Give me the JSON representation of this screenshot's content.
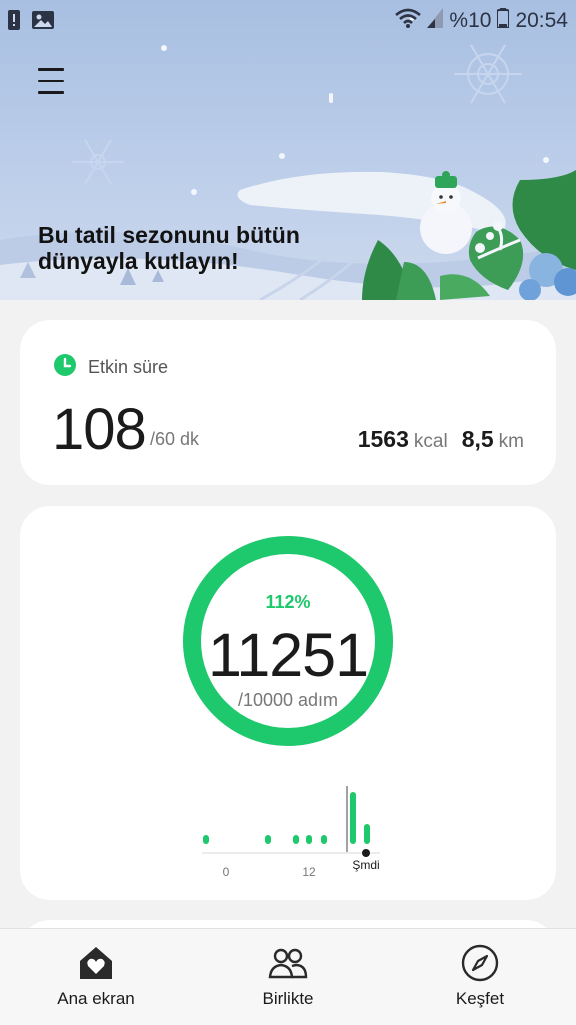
{
  "status_bar": {
    "battery_percent": "%10",
    "time": "20:54"
  },
  "banner": {
    "text": "Bu tatil sezonunu bütün dünyayla kutlayın!"
  },
  "active_time": {
    "title": "Etkin süre",
    "value": "108",
    "unit": "/60 dk",
    "calories_value": "1563",
    "calories_unit": "kcal",
    "distance_value": "8,5",
    "distance_unit": "km"
  },
  "steps": {
    "percent": "112%",
    "count": "11251",
    "goal": "/10000 adım",
    "progress_fraction": 1.0,
    "chart": {
      "tick_start": "0",
      "tick_mid": "12",
      "tick_now": "Şmdi"
    }
  },
  "nav": {
    "home": "Ana ekran",
    "together": "Birlikte",
    "discover": "Keşfet"
  },
  "colors": {
    "accent": "#1ec86c",
    "banner_sky": "#a8bfe1"
  },
  "icons": {
    "menu": "hamburger-icon",
    "active": "clock-icon",
    "home": "home-heart-icon",
    "together": "people-icon",
    "discover": "compass-icon"
  }
}
